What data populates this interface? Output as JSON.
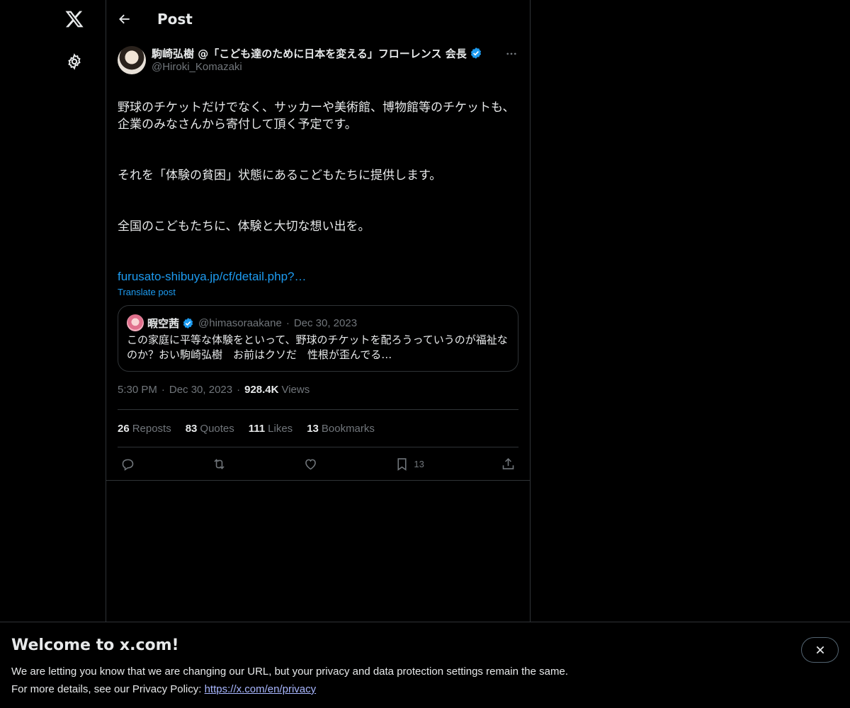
{
  "nav": {
    "icons": [
      "x-logo-icon",
      "gear-icon"
    ]
  },
  "header": {
    "title": "Post"
  },
  "post": {
    "author_name": "駒崎弘樹 @「こども達のために日本を変える」フローレンス 会長",
    "author_handle": "@Hiroki_Komazaki",
    "paragraphs": [
      "野球のチケットだけでなく、サッカーや美術館、博物館等のチケットも、\n企業のみなさんから寄付して頂く予定です。",
      "それを「体験の貧困」状態にあるこどもたちに提供します。",
      "全国のこどもたちに、体験と大切な想い出を。"
    ],
    "link_text": "furusato-shibuya.jp/cf/detail.php?…",
    "translate_label": "Translate post",
    "quote": {
      "name": "暇空茜",
      "handle": "@himasoraakane",
      "separator": "·",
      "date": "Dec 30, 2023",
      "text": "この家庭に平等な体験をといって、野球のチケットを配ろうっていうのが福祉なのか？おい駒崎弘樹　お前はクソだ　性根が歪んでる x.com/facts_gameo/st…"
    },
    "time": "5:30 PM",
    "separator": "·",
    "date": "Dec 30, 2023",
    "views_count": "928.4K",
    "views_label": "Views",
    "stats": {
      "reposts_num": "26",
      "reposts_label": "Reposts",
      "quotes_num": "83",
      "quotes_label": "Quotes",
      "likes_num": "111",
      "likes_label": "Likes",
      "bookmarks_num": "13",
      "bookmarks_label": "Bookmarks"
    },
    "actions": {
      "bookmark_count": "13"
    }
  },
  "banner": {
    "title": "Welcome to x.com!",
    "line1": "We are letting you know that we are changing our URL, but your privacy and data protection settings remain the same.",
    "line2_prefix": "For more details, see our Privacy Policy: ",
    "privacy_link": "https://x.com/en/privacy"
  },
  "colors": {
    "background": "#000000",
    "text": "#e7e9ea",
    "muted": "#71767b",
    "accent": "#1d9bf0",
    "border": "#2f3336"
  }
}
